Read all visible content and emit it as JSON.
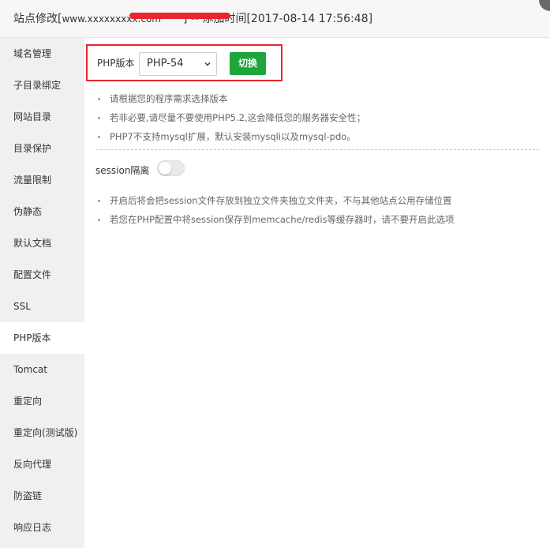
{
  "window": {
    "title_prefix": "站点修改[",
    "title_domain_redacted": "www.xxxxxxxxx.com",
    "title_suffix": "] -- 添加时间[2017-08-14 17:56:48]"
  },
  "sidebar": {
    "items": [
      {
        "label": "域名管理"
      },
      {
        "label": "子目录绑定"
      },
      {
        "label": "网站目录"
      },
      {
        "label": "目录保护"
      },
      {
        "label": "流量限制"
      },
      {
        "label": "伪静态"
      },
      {
        "label": "默认文档"
      },
      {
        "label": "配置文件"
      },
      {
        "label": "SSL"
      },
      {
        "label": "PHP版本",
        "active": true
      },
      {
        "label": "Tomcat"
      },
      {
        "label": "重定向"
      },
      {
        "label": "重定向(测试版)"
      },
      {
        "label": "反向代理"
      },
      {
        "label": "防盗链"
      },
      {
        "label": "响应日志"
      }
    ]
  },
  "php": {
    "label": "PHP版本",
    "selected_version": "PHP-54",
    "switch_label": "切换",
    "tips": [
      "请根据您的程序需求选择版本",
      "若非必要,请尽量不要使用PHP5.2,这会降低您的服务器安全性；",
      "PHP7不支持mysql扩展，默认安装mysqli以及mysql-pdo。"
    ]
  },
  "session": {
    "label": "session隔离",
    "enabled": false,
    "tips": [
      "开启后将会把session文件存放到独立文件夹独立文件夹，不与其他站点公用存储位置",
      "若您在PHP配置中将session保存到memcache/redis等缓存器时，请不要开启此选项"
    ]
  },
  "colors": {
    "accent_green": "#20a53a",
    "highlight_red": "#e8262f",
    "sidebar_bg": "#f0f0f0"
  }
}
